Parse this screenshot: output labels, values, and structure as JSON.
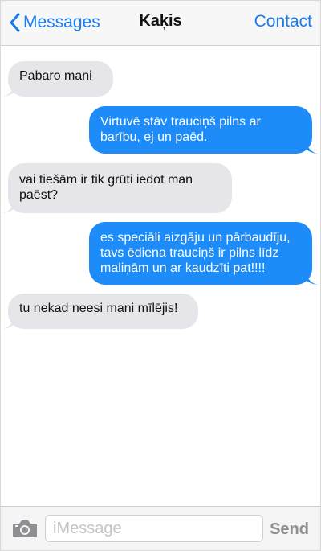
{
  "header": {
    "back_label": "Messages",
    "title": "Kaķis",
    "contact_label": "Contact"
  },
  "messages": [
    {
      "direction": "incoming",
      "text": "Pabaro mani"
    },
    {
      "direction": "outgoing",
      "text": "Virtuvē stāv trauciņš pilns ar barību, ej un paēd."
    },
    {
      "direction": "incoming",
      "text": "vai tiešām ir tik grūti iedot man paēst?"
    },
    {
      "direction": "outgoing",
      "text": "es speciāli aizgāju un pārbaudīju, tavs ēdiena trauciņš ir pilns līdz maliņām un ar kaudzīti pat!!!!"
    },
    {
      "direction": "incoming",
      "text": "tu nekad neesi mani mīlējis!"
    }
  ],
  "composer": {
    "placeholder": "iMessage",
    "send_label": "Send"
  },
  "colors": {
    "accent": "#1a7bf0",
    "outgoing_bubble": "#1d8cf8",
    "incoming_bubble": "#e5e5ea"
  },
  "icons": {
    "back": "chevron-left-icon",
    "camera": "camera-icon"
  }
}
